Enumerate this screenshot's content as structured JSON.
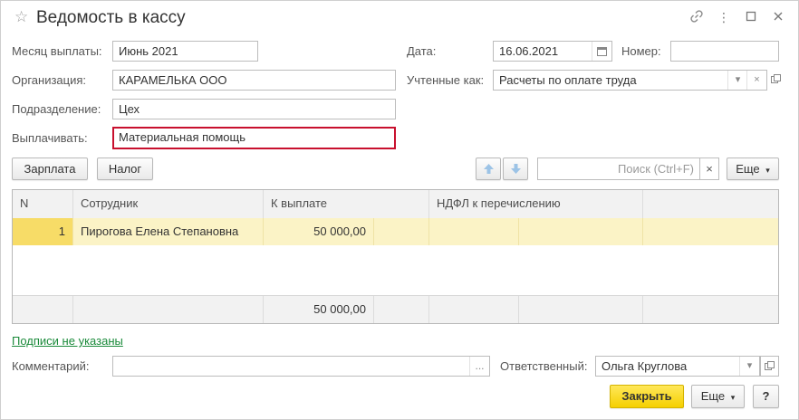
{
  "window": {
    "title": "Ведомость в кассу",
    "star_icon": "star-icon",
    "link_icon": "link-icon",
    "more_icon": "more-vertical-icon",
    "maximize_icon": "maximize-icon",
    "close_icon": "close-icon"
  },
  "form": {
    "month_label": "Месяц выплаты:",
    "month_value": "Июнь 2021",
    "date_label": "Дата:",
    "date_value": "16.06.2021",
    "number_label": "Номер:",
    "number_value": "",
    "org_label": "Организация:",
    "org_value": "КАРАМЕЛЬКА ООО",
    "accounted_label": "Учтенные как:",
    "accounted_value": "Расчеты по оплате труда",
    "dept_label": "Подразделение:",
    "dept_value": "Цех",
    "pay_label": "Выплачивать:",
    "pay_value": "Материальная помощь"
  },
  "toolbar": {
    "salary_button": "Зарплата",
    "tax_button": "Налог",
    "search_placeholder": "Поиск (Ctrl+F)",
    "search_clear": "×",
    "more_button": "Еще"
  },
  "table": {
    "columns": [
      "N",
      "Сотрудник",
      "К выплате",
      "НДФЛ к перечислению"
    ],
    "rows": [
      {
        "n": "1",
        "employee": "Пирогова Елена Степановна",
        "amount": "50 000,00",
        "ndfl": ""
      }
    ],
    "total_amount": "50 000,00"
  },
  "footer": {
    "signatures_link": "Подписи не указаны",
    "comment_label": "Комментарий:",
    "comment_value": "",
    "comment_btn": "...",
    "responsible_label": "Ответственный:",
    "responsible_value": "Ольга Круглова",
    "close_button": "Закрыть",
    "more_button": "Еще",
    "help_button": "?"
  },
  "colors": {
    "accent_yellow": "#f5d000",
    "highlight_row": "#fbf3c6",
    "error_border": "#c8102e",
    "link_green": "#1a8a3a"
  }
}
